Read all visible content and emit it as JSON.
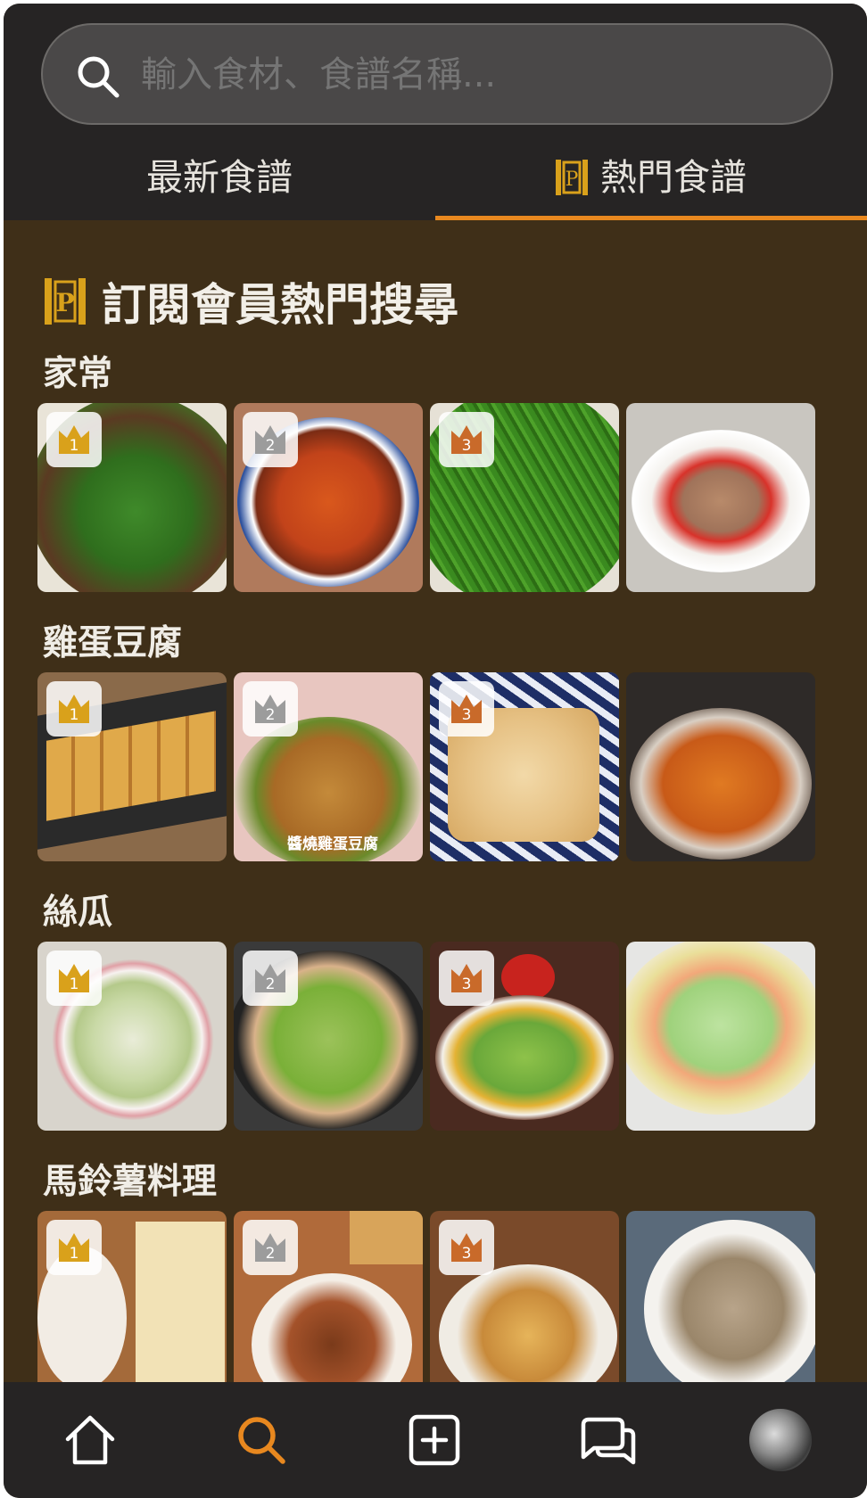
{
  "search": {
    "placeholder": "輸入食材、食譜名稱..."
  },
  "tabs": {
    "latest": "最新食譜",
    "popular": "熱門食譜",
    "active": "popular"
  },
  "section": {
    "title": "訂閱會員熱門搜尋",
    "badge_icon": "premium-p-icon"
  },
  "categories": [
    {
      "label": "家常",
      "ranks": [
        "1",
        "2",
        "3"
      ]
    },
    {
      "label": "雞蛋豆腐",
      "ranks": [
        "1",
        "2",
        "3"
      ]
    },
    {
      "label": "絲瓜",
      "ranks": [
        "1",
        "2",
        "3"
      ]
    },
    {
      "label": "馬鈴薯料理",
      "ranks": [
        "1",
        "2",
        "3"
      ]
    }
  ],
  "photo_captions": {
    "tofu_2": "醬燒雞蛋豆腐"
  },
  "nav": [
    "home-icon",
    "search-icon",
    "add-icon",
    "chat-icon",
    "avatar"
  ],
  "colors": {
    "accent": "#e8881f",
    "gold": "#d9a11b",
    "silver": "#9c9c9c",
    "bronze": "#c96a2a",
    "background": "#3f2f18",
    "bar": "#262424"
  }
}
